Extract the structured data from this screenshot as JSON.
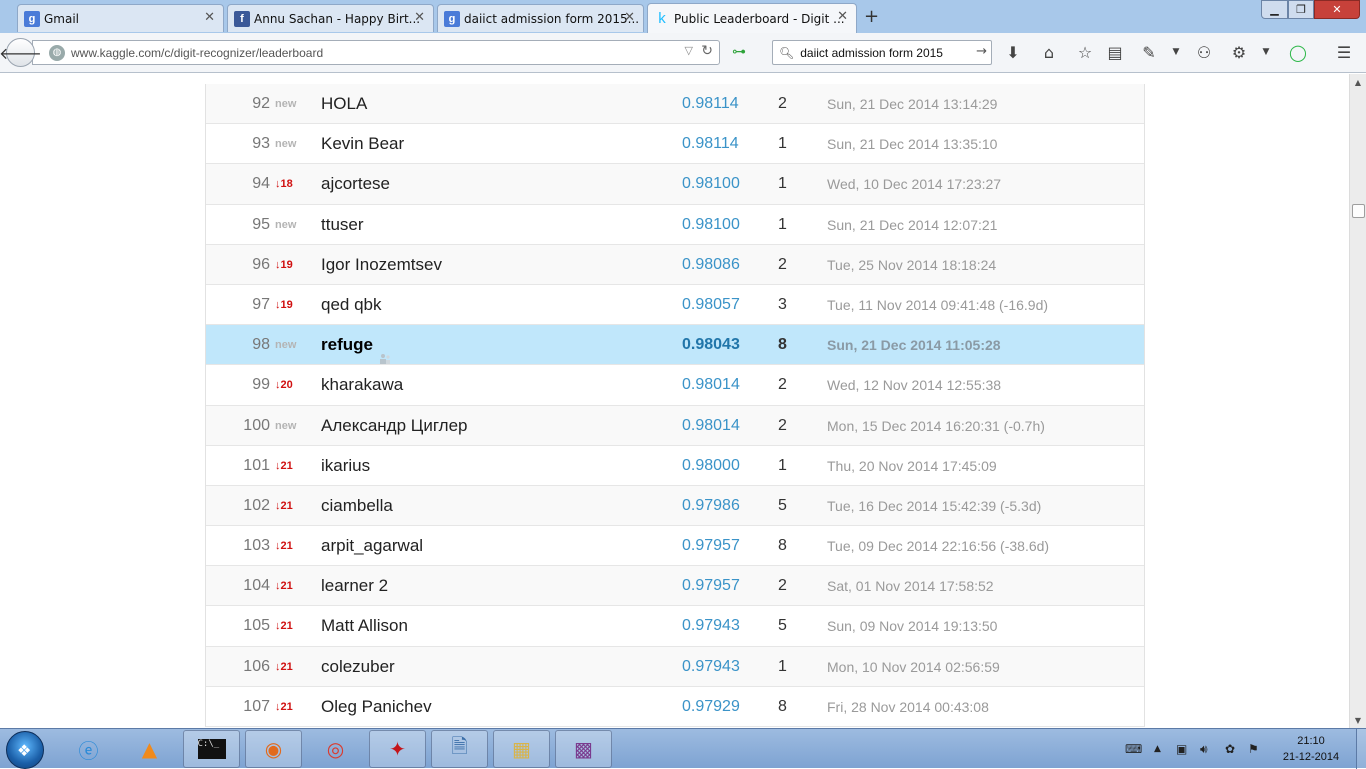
{
  "browser": {
    "tabs": [
      {
        "title": "Gmail",
        "favicon": "google-g",
        "favicon_color": "#4a7bd8",
        "active": false
      },
      {
        "title": "Annu Sachan - Happy Birt...",
        "favicon": "facebook-f",
        "favicon_color": "#3b5998",
        "active": false
      },
      {
        "title": "daiict admission form 2015...",
        "favicon": "google-g",
        "favicon_color": "#4a7bd8",
        "active": false
      },
      {
        "title": "Public Leaderboard - Digit ...",
        "favicon": "kaggle-k",
        "favicon_color": "#20beff",
        "active": true
      }
    ],
    "url": "www.kaggle.com/c/digit-recognizer/leaderboard",
    "search_value": "daiict admission form 2015"
  },
  "leaderboard": {
    "rows": [
      {
        "rank": "92",
        "delta": "new",
        "delta_type": "new",
        "team": "HOLA",
        "score": "0.98114",
        "entries": "2",
        "last": "Sun, 21 Dec 2014 13:14:29"
      },
      {
        "rank": "93",
        "delta": "new",
        "delta_type": "new",
        "team": "Kevin Bear",
        "score": "0.98114",
        "entries": "1",
        "last": "Sun, 21 Dec 2014 13:35:10"
      },
      {
        "rank": "94",
        "delta": "↓18",
        "delta_type": "down",
        "team": "ajcortese",
        "score": "0.98100",
        "entries": "1",
        "last": "Wed, 10 Dec 2014 17:23:27"
      },
      {
        "rank": "95",
        "delta": "new",
        "delta_type": "new",
        "team": "ttuser",
        "score": "0.98100",
        "entries": "1",
        "last": "Sun, 21 Dec 2014 12:07:21"
      },
      {
        "rank": "96",
        "delta": "↓19",
        "delta_type": "down",
        "team": "Igor Inozemtsev",
        "score": "0.98086",
        "entries": "2",
        "last": "Tue, 25 Nov 2014 18:18:24"
      },
      {
        "rank": "97",
        "delta": "↓19",
        "delta_type": "down",
        "team": "qed qbk",
        "score": "0.98057",
        "entries": "3",
        "last": "Tue, 11 Nov 2014 09:41:48 (-16.9d)"
      },
      {
        "rank": "98",
        "delta": "new",
        "delta_type": "new",
        "team": "refuge",
        "score": "0.98043",
        "entries": "8",
        "last": "Sun, 21 Dec 2014 11:05:28",
        "highlight": true
      },
      {
        "rank": "99",
        "delta": "↓20",
        "delta_type": "down",
        "team": "kharakawa",
        "score": "0.98014",
        "entries": "2",
        "last": "Wed, 12 Nov 2014 12:55:38"
      },
      {
        "rank": "100",
        "delta": "new",
        "delta_type": "new",
        "team": "Александр Циглер",
        "score": "0.98014",
        "entries": "2",
        "last": "Mon, 15 Dec 2014 16:20:31 (-0.7h)"
      },
      {
        "rank": "101",
        "delta": "↓21",
        "delta_type": "down",
        "team": "ikarius",
        "score": "0.98000",
        "entries": "1",
        "last": "Thu, 20 Nov 2014 17:45:09"
      },
      {
        "rank": "102",
        "delta": "↓21",
        "delta_type": "down",
        "team": "ciambella",
        "score": "0.97986",
        "entries": "5",
        "last": "Tue, 16 Dec 2014 15:42:39 (-5.3d)"
      },
      {
        "rank": "103",
        "delta": "↓21",
        "delta_type": "down",
        "team": "arpit_agarwal",
        "score": "0.97957",
        "entries": "8",
        "last": "Tue, 09 Dec 2014 22:16:56 (-38.6d)"
      },
      {
        "rank": "104",
        "delta": "↓21",
        "delta_type": "down",
        "team": "learner 2",
        "score": "0.97957",
        "entries": "2",
        "last": "Sat, 01 Nov 2014 17:58:52"
      },
      {
        "rank": "105",
        "delta": "↓21",
        "delta_type": "down",
        "team": "Matt Allison",
        "score": "0.97943",
        "entries": "5",
        "last": "Sun, 09 Nov 2014 19:13:50"
      },
      {
        "rank": "106",
        "delta": "↓21",
        "delta_type": "down",
        "team": "colezuber",
        "score": "0.97943",
        "entries": "1",
        "last": "Mon, 10 Nov 2014 02:56:59"
      },
      {
        "rank": "107",
        "delta": "↓21",
        "delta_type": "down",
        "team": "Oleg Panichev",
        "score": "0.97929",
        "entries": "8",
        "last": "Fri, 28 Nov 2014 00:43:08"
      }
    ]
  },
  "taskbar": {
    "apps": [
      "internet-explorer-icon",
      "vlc-icon",
      "command-prompt-icon",
      "firefox-icon",
      "chrome-icon",
      "acrobat-icon",
      "python-icon",
      "file-explorer-icon",
      "winrar-icon"
    ],
    "clock_time": "21:10",
    "clock_date": "21-12-2014"
  },
  "colors": {
    "highlight_row": "#c0e7fb",
    "score_blue": "#3a93c8",
    "rank_down_red": "#d01010",
    "new_gray": "#b4b4b4"
  }
}
